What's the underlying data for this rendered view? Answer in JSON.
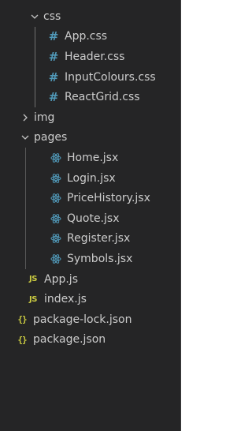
{
  "explorer": {
    "folder_css": "css",
    "folder_img": "img",
    "folder_pages": "pages",
    "css_files": [
      "App.css",
      "Header.css",
      "InputColours.css",
      "ReactGrid.css"
    ],
    "page_files": [
      "Home.jsx",
      "Login.jsx",
      "PriceHistory.jsx",
      "Quote.jsx",
      "Register.jsx",
      "Symbols.jsx"
    ],
    "root_files": [
      {
        "name": "App.js",
        "icon": "JS"
      },
      {
        "name": "index.js",
        "icon": "JS"
      },
      {
        "name": "package-lock.json",
        "icon": "{}"
      },
      {
        "name": "package.json",
        "icon": "{}"
      }
    ],
    "icon_css_glyph": "#",
    "colors": {
      "background": "#252526",
      "text": "#cccccc",
      "css_icon": "#519aba",
      "js_icon": "#cbcb41",
      "json_icon": "#cbcb41",
      "react_icon": "#519aba"
    }
  }
}
